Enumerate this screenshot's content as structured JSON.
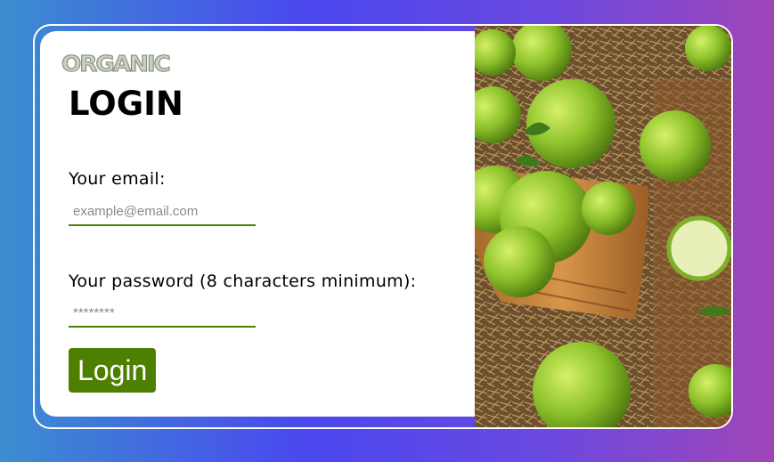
{
  "logo": {
    "text": "ORGANIC"
  },
  "login": {
    "title": "LOGIN",
    "email_label": "Your email:",
    "email_placeholder": "example@email.com",
    "email_value": "",
    "password_label": "Your password (8 characters minimum):",
    "password_placeholder": "********",
    "password_value": "",
    "submit_label": "Login"
  },
  "colors": {
    "accent": "#4f7f00",
    "field_underline": "#4e7e0a",
    "background_gradient_left": "#3b8ed0",
    "background_gradient_mid": "#4a47ef",
    "background_gradient_right": "#a045b8"
  },
  "photo": {
    "subject": "green-apples-in-wooden-bucket-image"
  }
}
